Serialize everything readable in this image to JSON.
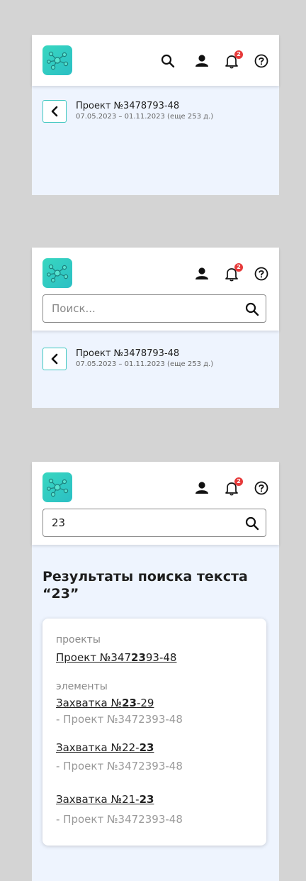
{
  "colors": {
    "accent": "#3ec7c0",
    "badge": "#e63a3a",
    "panel": "#eef4fe"
  },
  "notifications_count": "2",
  "project": {
    "title": "Проект №3478793-48",
    "dates": "07.05.2023 – 01.11.2023 (еще 253 д.)"
  },
  "search": {
    "placeholder": "Поиск...",
    "query": "23"
  },
  "results": {
    "title": "Результаты поиска текста “23”",
    "projects_caption": "проекты",
    "project_result": {
      "pre": "Проект №347",
      "hl": "23",
      "post": "93-48"
    },
    "elements_caption": "элементы",
    "elements": [
      {
        "pre": "Захватка №",
        "hl": "23",
        "post": "-29",
        "parent": "- Проект №3472393-48"
      },
      {
        "pre": "Захватка №22-",
        "hl": "23",
        "post": "",
        "parent": "- Проект №3472393-48"
      },
      {
        "pre": "Захватка №21-",
        "hl": "23",
        "post": "",
        "parent": "- Проект №3472393-48"
      }
    ]
  }
}
